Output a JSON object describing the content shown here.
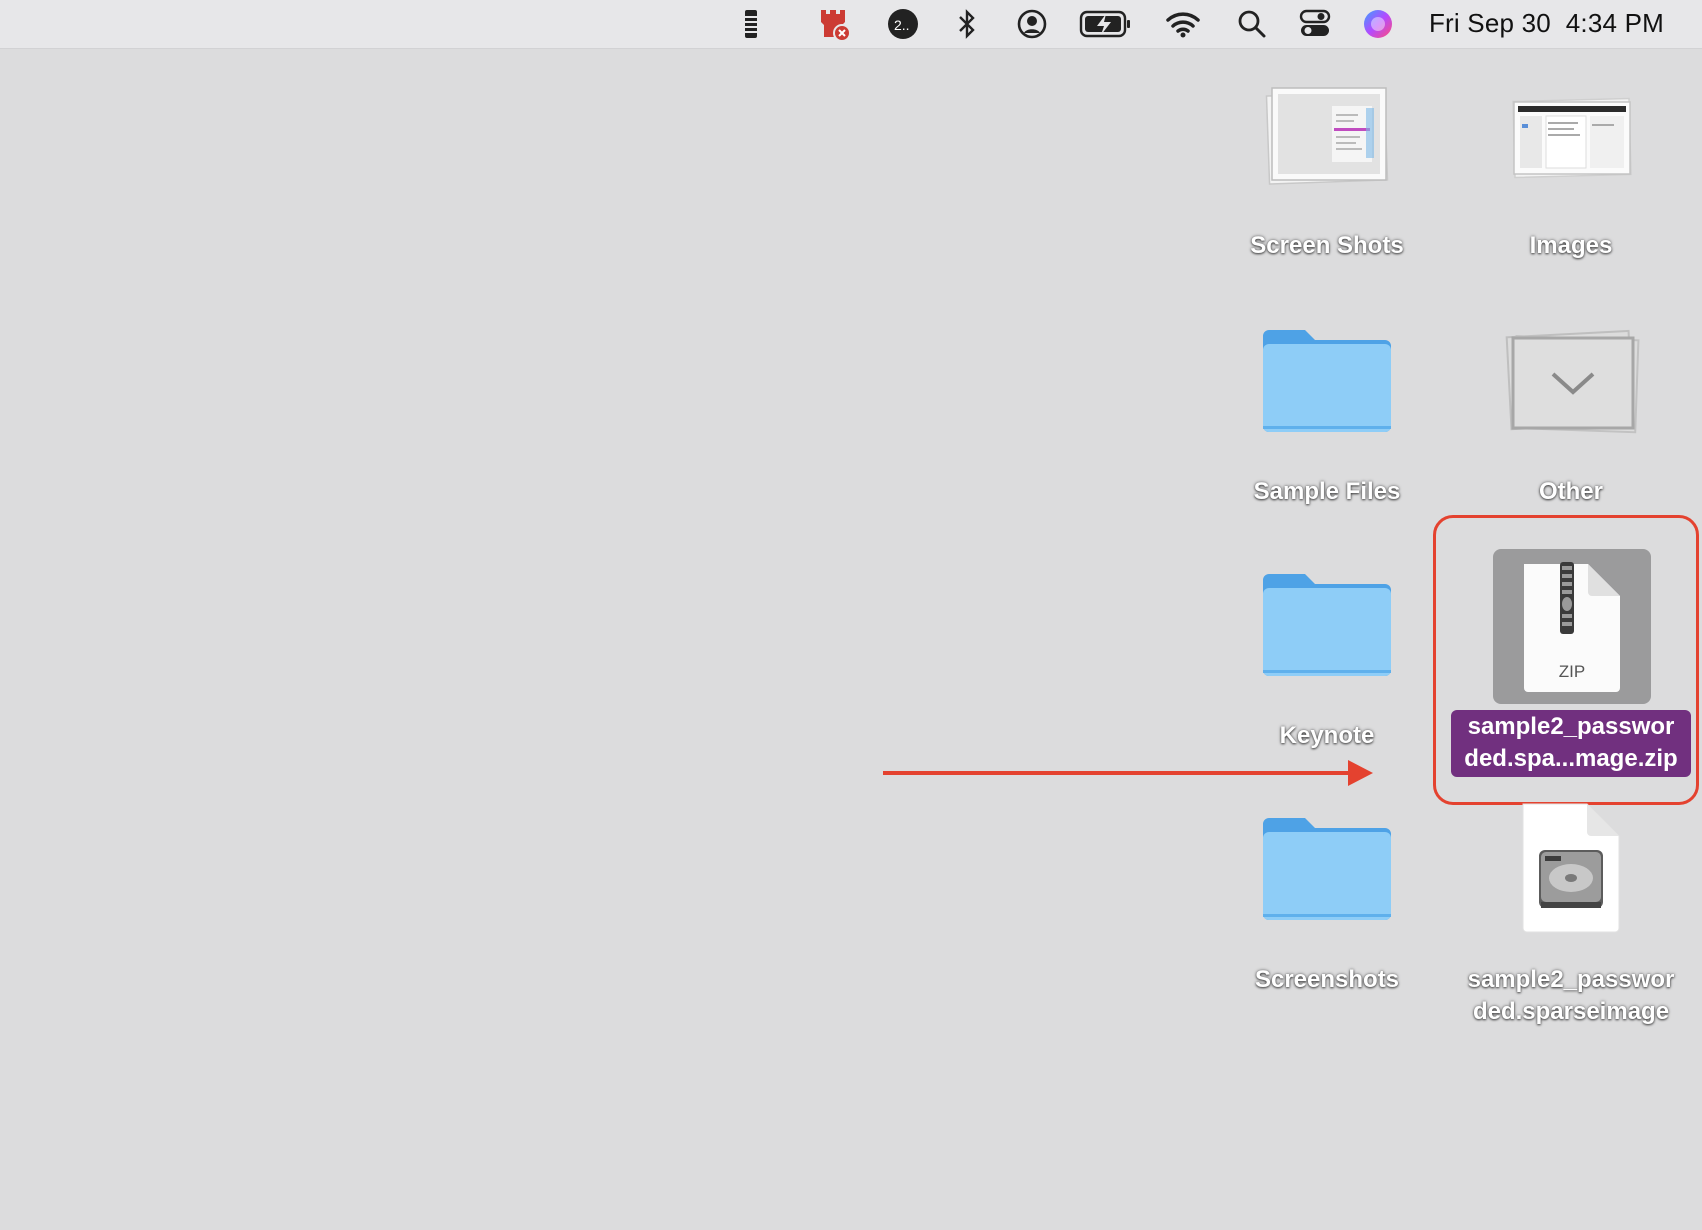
{
  "menubar": {
    "icons": [
      "flashlight-icon",
      "tower-blocked-icon",
      "disk-status-icon",
      "bluetooth-icon",
      "user-account-icon",
      "battery-charging-icon",
      "wifi-icon",
      "spotlight-search-icon",
      "control-center-icon",
      "siri-icon"
    ],
    "clock": "Fri Sep 30  4:34 PM"
  },
  "desktop": {
    "items": [
      {
        "label": "Screen Shots",
        "icon": "screenshot-stack-icon"
      },
      {
        "label": "Images",
        "icon": "image-stack-icon"
      },
      {
        "label": "Sample Files",
        "icon": "folder-icon"
      },
      {
        "label": "Other",
        "icon": "other-stack-icon"
      },
      {
        "label": "Keynote",
        "icon": "folder-icon"
      },
      {
        "label": "sample2_passwor ded.spa...mage.zip",
        "line1": "sample2_passwor",
        "line2": "ded.spa...mage.zip",
        "icon": "zip-archive-icon",
        "selected": true,
        "badge": "ZIP"
      },
      {
        "label": "Screenshots",
        "icon": "folder-icon"
      },
      {
        "label": "sample2_passwor ded.sparseimage",
        "line1": "sample2_passwor",
        "line2": "ded.sparseimage",
        "icon": "disk-image-icon"
      }
    ]
  },
  "colors": {
    "annotation": "#e4422f",
    "selection_label": "#71307f",
    "folder": "#8ecdf7"
  }
}
